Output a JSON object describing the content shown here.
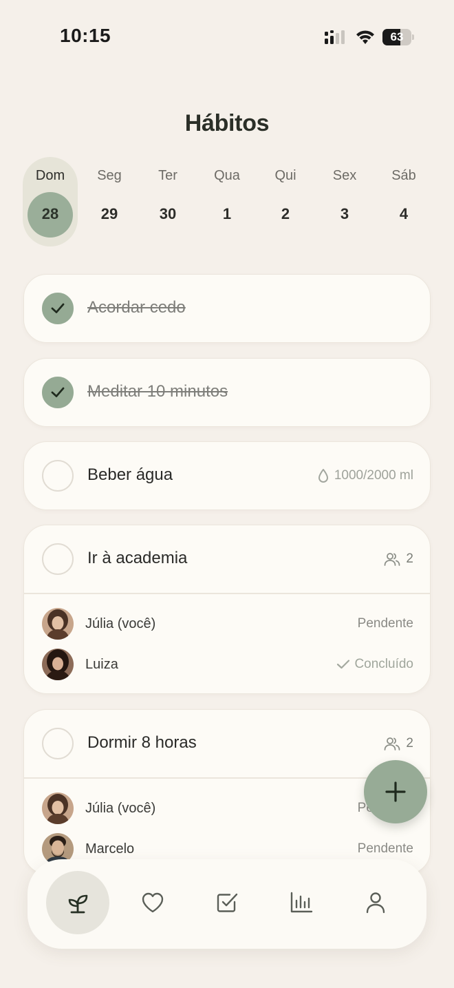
{
  "status_bar": {
    "time": "10:15",
    "battery": "63",
    "battery_level": 0.63
  },
  "page": {
    "title": "Hábitos"
  },
  "week": [
    {
      "name": "Dom",
      "num": "28",
      "selected": true
    },
    {
      "name": "Seg",
      "num": "29"
    },
    {
      "name": "Ter",
      "num": "30"
    },
    {
      "name": "Qua",
      "num": "1"
    },
    {
      "name": "Qui",
      "num": "2"
    },
    {
      "name": "Sex",
      "num": "3"
    },
    {
      "name": "Sáb",
      "num": "4"
    }
  ],
  "habits": [
    {
      "name": "Acordar cedo",
      "done": true
    },
    {
      "name": "Meditar 10 minutos",
      "done": true
    },
    {
      "name": "Beber água",
      "done": false,
      "progress": "1000/2000 ml"
    },
    {
      "name": "Ir à academia",
      "done": false,
      "participants": "2",
      "members": [
        {
          "name": "Júlia (você)",
          "status": "Pendente"
        },
        {
          "name": "Luiza",
          "status": "Concluído",
          "completed": true
        }
      ]
    },
    {
      "name": "Dormir 8 horas",
      "done": false,
      "participants": "2",
      "members": [
        {
          "name": "Júlia (você)",
          "status": "Pendente"
        },
        {
          "name": "Marcelo",
          "status": "Pendente"
        }
      ]
    }
  ],
  "colors": {
    "accent": "#97ab96",
    "background": "#f5f0ea",
    "card": "#fdfbf6"
  },
  "nav": [
    {
      "icon": "sprout-icon",
      "active": true
    },
    {
      "icon": "heart-icon"
    },
    {
      "icon": "checkbox-icon"
    },
    {
      "icon": "bar-chart-icon"
    },
    {
      "icon": "user-icon"
    }
  ]
}
